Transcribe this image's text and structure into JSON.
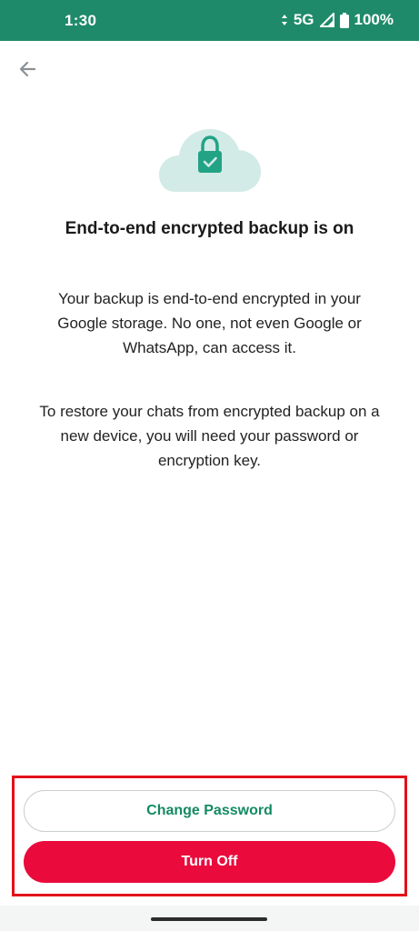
{
  "status_bar": {
    "time": "1:30",
    "network": "5G",
    "battery": "100%",
    "icons": [
      "data-arrows-icon",
      "signal-icon",
      "battery-icon"
    ],
    "background_color": "#1f8a69"
  },
  "header": {
    "back_icon": "arrow-left-icon"
  },
  "hero": {
    "icon": "cloud-lock-check-icon",
    "cloud_color": "#d3ebe6",
    "lock_color": "#22a386"
  },
  "content": {
    "title": "End-to-end encrypted backup is on",
    "paragraph_1": "Your backup is end-to-end encrypted in your Google storage. No one, not even Google or WhatsApp, can access it.",
    "paragraph_2": "To restore your chats from encrypted backup on a new device, you will need your password or encryption key."
  },
  "actions": {
    "change_password_label": "Change Password",
    "turn_off_label": "Turn Off",
    "accent_color": "#148a63",
    "danger_color": "#ea0a3c"
  }
}
